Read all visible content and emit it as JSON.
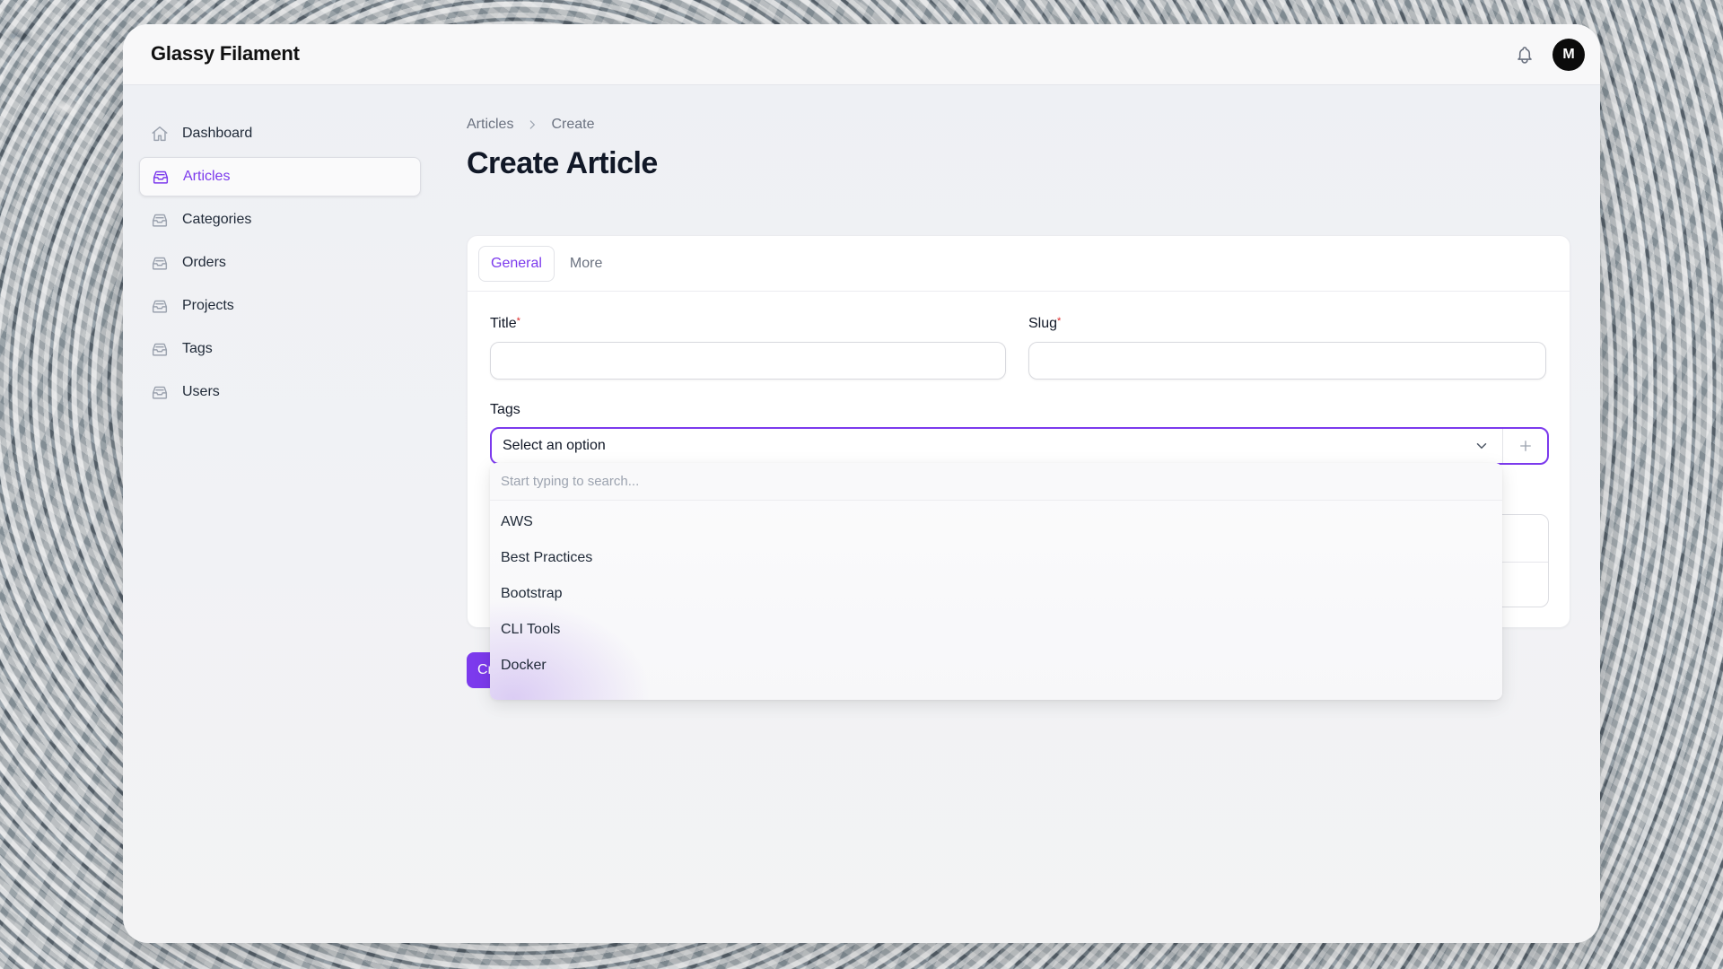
{
  "app": {
    "brand": "Glassy Filament",
    "avatar_initial": "M"
  },
  "sidebar": {
    "items": [
      {
        "label": "Dashboard",
        "icon": "home-icon",
        "active": false
      },
      {
        "label": "Articles",
        "icon": "inbox-stack-icon",
        "active": true
      },
      {
        "label": "Categories",
        "icon": "inbox-stack-icon",
        "active": false
      },
      {
        "label": "Orders",
        "icon": "inbox-stack-icon",
        "active": false
      },
      {
        "label": "Projects",
        "icon": "inbox-stack-icon",
        "active": false
      },
      {
        "label": "Tags",
        "icon": "inbox-stack-icon",
        "active": false
      },
      {
        "label": "Users",
        "icon": "inbox-stack-icon",
        "active": false
      }
    ]
  },
  "breadcrumb": {
    "items": [
      "Articles",
      "Create"
    ]
  },
  "page": {
    "title": "Create Article"
  },
  "form": {
    "tabs": [
      {
        "label": "General",
        "active": true
      },
      {
        "label": "More",
        "active": false
      }
    ],
    "title_label": "Title",
    "slug_label": "Slug",
    "required_marker": "*",
    "tags_label": "Tags",
    "tags_placeholder": "Select an option",
    "create_button_label": "Cr"
  },
  "dropdown": {
    "search_placeholder": "Start typing to search...",
    "options": [
      "AWS",
      "Best Practices",
      "Bootstrap",
      "CLI Tools",
      "Docker"
    ]
  },
  "colors": {
    "accent": "#7c3aed",
    "required": "#dc2626"
  }
}
